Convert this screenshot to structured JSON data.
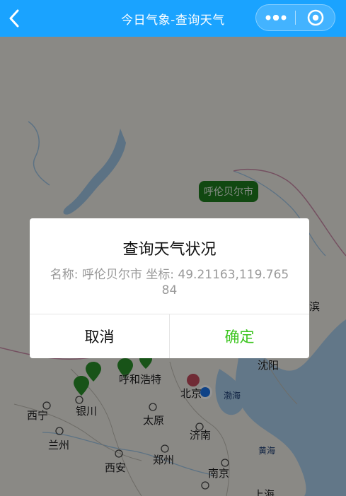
{
  "navbar": {
    "title": "今日气象-查询天气",
    "background": "#1aa3ff",
    "back_icon": "chevron-left-icon",
    "menu_icon": "more-dots-icon",
    "close_icon": "target-circle-icon"
  },
  "map": {
    "marker_tag": "呼伦贝尔市",
    "cities": [
      "滨",
      "沈阳",
      "呼和浩特",
      "北京",
      "西宁",
      "银川",
      "太原",
      "济南",
      "兰州",
      "郑州",
      "西安",
      "南京",
      "上海"
    ],
    "seas": [
      "渤海",
      "黄海"
    ]
  },
  "dialog": {
    "title": "查询天气状况",
    "content": "名称: 呼伦贝尔市 坐标: 49.21163,119.76584",
    "cancel_label": "取消",
    "confirm_label": "确定",
    "confirm_color": "#3cc51f"
  }
}
